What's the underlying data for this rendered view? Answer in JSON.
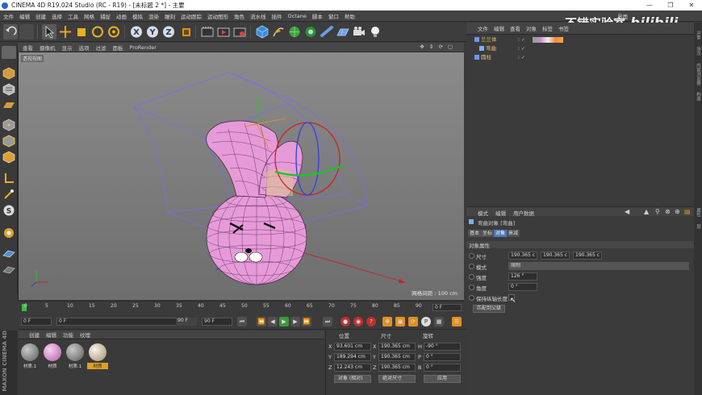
{
  "window": {
    "title": "CINEMA 4D R19.024 Studio (RC - R19) - [未标题 2 *] - 主要",
    "controls": [
      "—",
      "❐",
      "✕"
    ]
  },
  "menubar": {
    "items": [
      "文件",
      "编辑",
      "创建",
      "选择",
      "工具",
      "网格",
      "捕捉",
      "动画",
      "模拟",
      "渲染",
      "雕刻",
      "运动跟踪",
      "运动图形",
      "角色",
      "流水线",
      "插件",
      "Octane",
      "脚本",
      "窗口",
      "帮助"
    ],
    "layout_label": "界面"
  },
  "viewport": {
    "menu": [
      "查看",
      "摄像机",
      "显示",
      "选项",
      "过滤",
      "面板",
      "ProRender"
    ],
    "view_label": "透视视图",
    "grid_spacing": "网格间距 : 100 cm"
  },
  "timeline": {
    "ticks": [
      "0",
      "5",
      "10",
      "15",
      "20",
      "25",
      "30",
      "35",
      "40",
      "45",
      "50",
      "55",
      "60",
      "65",
      "70",
      "75",
      "80",
      "85",
      "90"
    ],
    "end_frame_display": "0 F"
  },
  "transport": {
    "current_frame": "0 F",
    "start_frame": "0 F",
    "preview_max": "90 F",
    "end_frame": "90 F"
  },
  "materials": {
    "menu": [
      "创建",
      "编辑",
      "功能",
      "纹理"
    ],
    "items": [
      {
        "label": "材质.1",
        "color": "#7a7a7a"
      },
      {
        "label": "材质",
        "color": "#d88fcf"
      },
      {
        "label": "材质.1",
        "color": "#7a7a7a"
      },
      {
        "label": "材质",
        "color": "#d8cfb8"
      }
    ]
  },
  "coordinates": {
    "headers": [
      "位置",
      "尺寸",
      "旋转"
    ],
    "rows": [
      {
        "axis": "X",
        "pos": "93.601 cm",
        "size": "190.365 cm",
        "rot_label": "H",
        "rot": "-90 °"
      },
      {
        "axis": "Y",
        "pos": "189.294 cm",
        "size": "190.365 cm",
        "rot_label": "P",
        "rot": "0 °"
      },
      {
        "axis": "Z",
        "pos": "12.243 cm",
        "size": "190.365 cm",
        "rot_label": "B",
        "rot": "0 °"
      }
    ],
    "mode_dropdown": "对象 (相对)",
    "size_dropdown": "绝对尺寸",
    "apply_button": "应用"
  },
  "object_manager": {
    "menu": [
      "文件",
      "编辑",
      "查看",
      "对象",
      "标签",
      "书签"
    ],
    "objects": [
      {
        "name": "兰兰体",
        "indent": 0
      },
      {
        "name": "弯曲",
        "indent": 1
      },
      {
        "name": "圆柱",
        "indent": 0
      }
    ]
  },
  "attribute_manager": {
    "menu": [
      "模式",
      "编辑",
      "用户数据"
    ],
    "object_title": "弯曲对象 [弯曲]",
    "tabs": [
      "基本",
      "坐标",
      "对象",
      "衰减"
    ],
    "active_tab": "对象",
    "section": "对象属性",
    "size_label": "尺寸",
    "size_values": [
      "190.365 c",
      "190.365 c",
      "190.365 c"
    ],
    "mode_label": "模式",
    "mode_value": "限制",
    "strength_label": "强度",
    "strength_value": "126 °",
    "angle_label": "角度",
    "angle_value": "0 °",
    "keep_length_label": "保持纵轴长度",
    "match_button": "匹配到父级"
  },
  "right_strip": [
    "对象",
    "场次",
    "内容浏览器",
    "构造",
    "属性",
    "层"
  ],
  "watermark": {
    "text": "不错实验室",
    "brand": "bilibili"
  }
}
